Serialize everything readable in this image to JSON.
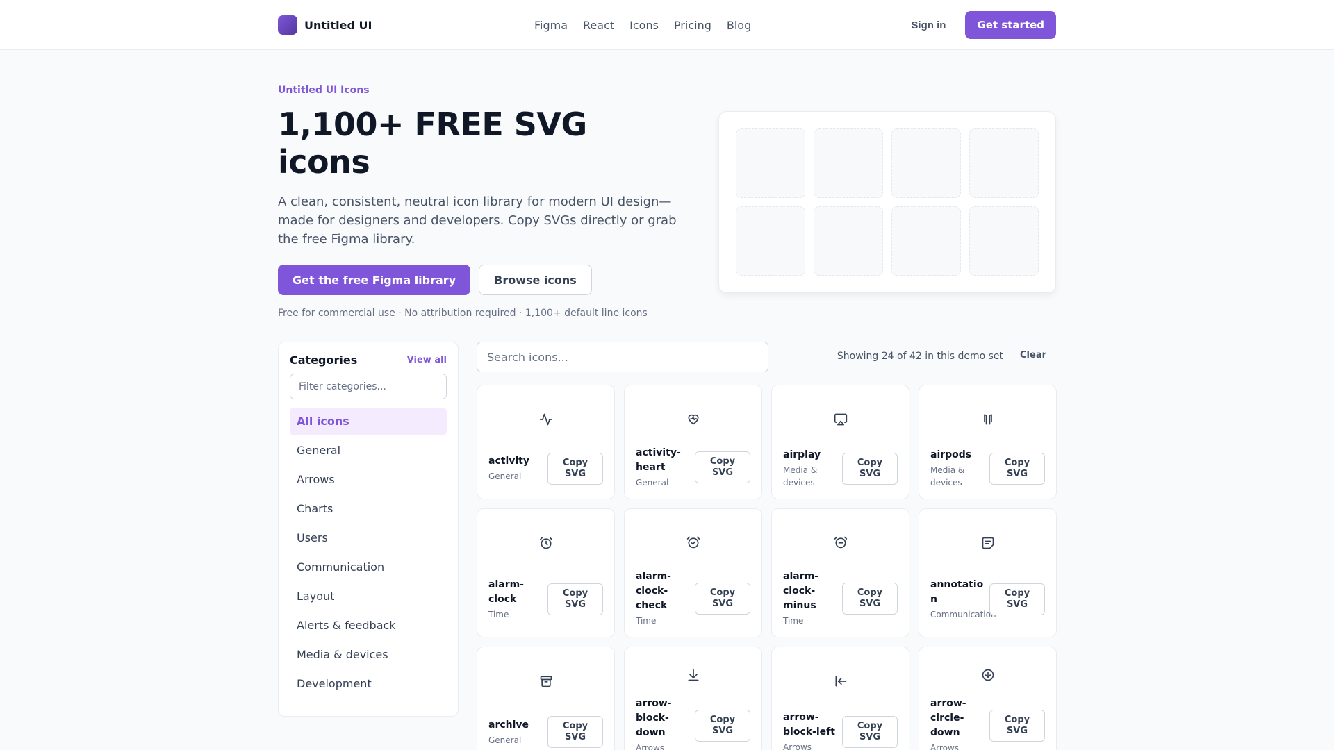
{
  "header": {
    "brand": "Untitled UI",
    "nav": [
      "Figma",
      "React",
      "Icons",
      "Pricing",
      "Blog"
    ],
    "signin": "Sign in",
    "get_started": "Get started"
  },
  "hero": {
    "eyebrow": "Untitled UI Icons",
    "title": "1,100+ FREE SVG icons",
    "subtitle": "A clean, consistent, neutral icon library for modern UI design—made for designers and developers. Copy SVGs directly or grab the free Figma library.",
    "cta_primary": "Get the free Figma library",
    "cta_secondary": "Browse icons",
    "note": "Free for commercial use · No attribution required · 1,100+ default line icons"
  },
  "sidebar": {
    "title": "Categories",
    "view_all": "View all",
    "filter_placeholder": "Filter categories...",
    "items": [
      "All icons",
      "General",
      "Arrows",
      "Charts",
      "Users",
      "Communication",
      "Layout",
      "Alerts & feedback",
      "Media & devices",
      "Development"
    ]
  },
  "main": {
    "search_placeholder": "Search icons...",
    "showing": "Showing 24 of 42 in this demo set",
    "clear": "Clear"
  },
  "icons": [
    {
      "name": "activity",
      "category": "General",
      "copy": "Copy SVG",
      "icon": "activity-icon"
    },
    {
      "name": "activity-heart",
      "category": "General",
      "copy": "Copy SVG",
      "icon": "activity-heart-icon"
    },
    {
      "name": "airplay",
      "category": "Media & devices",
      "copy": "Copy SVG",
      "icon": "airplay-icon"
    },
    {
      "name": "airpods",
      "category": "Media & devices",
      "copy": "Copy SVG",
      "icon": "airpods-icon"
    },
    {
      "name": "alarm-clock",
      "category": "Time",
      "copy": "Copy SVG",
      "icon": "alarm-clock-icon"
    },
    {
      "name": "alarm-clock-check",
      "category": "Time",
      "copy": "Copy SVG",
      "icon": "alarm-clock-check-icon"
    },
    {
      "name": "alarm-clock-minus",
      "category": "Time",
      "copy": "Copy SVG",
      "icon": "alarm-clock-minus-icon"
    },
    {
      "name": "annotation",
      "category": "Communication",
      "copy": "Copy SVG",
      "icon": "annotation-icon"
    },
    {
      "name": "archive",
      "category": "General",
      "copy": "Copy SVG",
      "icon": "archive-icon"
    },
    {
      "name": "arrow-block-down",
      "category": "Arrows",
      "copy": "Copy SVG",
      "icon": "arrow-down-icon"
    },
    {
      "name": "arrow-block-left",
      "category": "Arrows",
      "copy": "Copy SVG",
      "icon": "arrow-left-icon"
    },
    {
      "name": "arrow-circle-down",
      "category": "Arrows",
      "copy": "Copy SVG",
      "icon": "arrow-circle-down-icon"
    }
  ],
  "colors": {
    "accent": "#7f56d9",
    "accent_soft": "#f4ebff",
    "text": "#101828",
    "muted": "#667085",
    "border": "#eaecf0"
  }
}
